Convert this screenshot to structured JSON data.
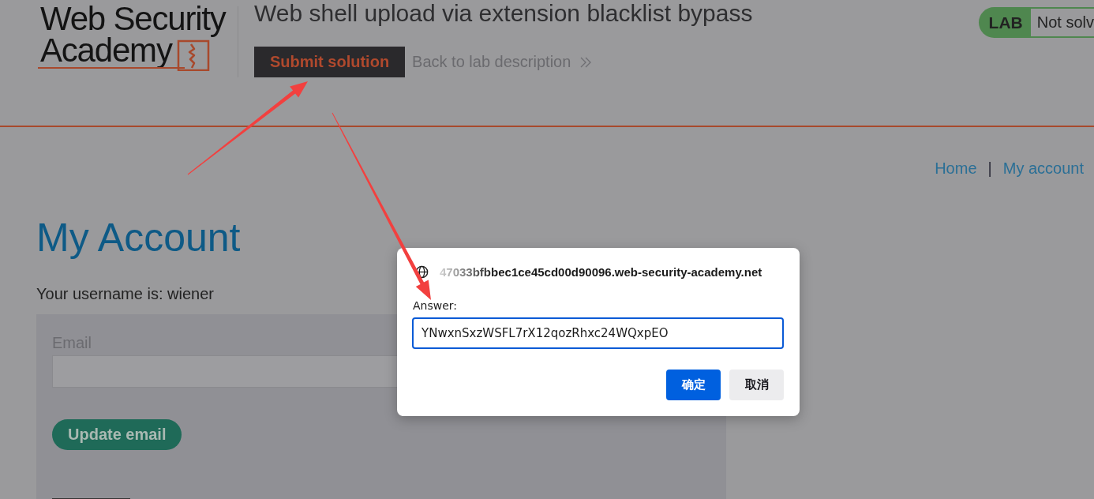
{
  "header": {
    "logo": {
      "lines": [
        "Web Security",
        "Academy"
      ]
    },
    "lab_title": "Web shell upload via extension blacklist bypass",
    "submit_button": "Submit solution",
    "back_link": "Back to lab description",
    "lab_status": {
      "label": "LAB",
      "status": "Not solv",
      "solved": false
    }
  },
  "nav": {
    "links": [
      "Home",
      "My account"
    ],
    "separator": "|"
  },
  "account": {
    "heading": "My Account",
    "username_line": "Your username is: wiener",
    "form": {
      "email_label": "Email",
      "submit_button": "Update email"
    }
  },
  "dialog": {
    "origin": "47033bfbbec1ce45cd00d90096.web-security-academy.net",
    "prompt_label": "Answer:",
    "answer_value": "YNwxnSxzWSFL7rX12qozRhxc24WQxpEO",
    "focused": true,
    "buttons": [
      {
        "label": "确定",
        "kind": "primary"
      },
      {
        "label": "取消",
        "kind": "secondary"
      }
    ]
  }
}
